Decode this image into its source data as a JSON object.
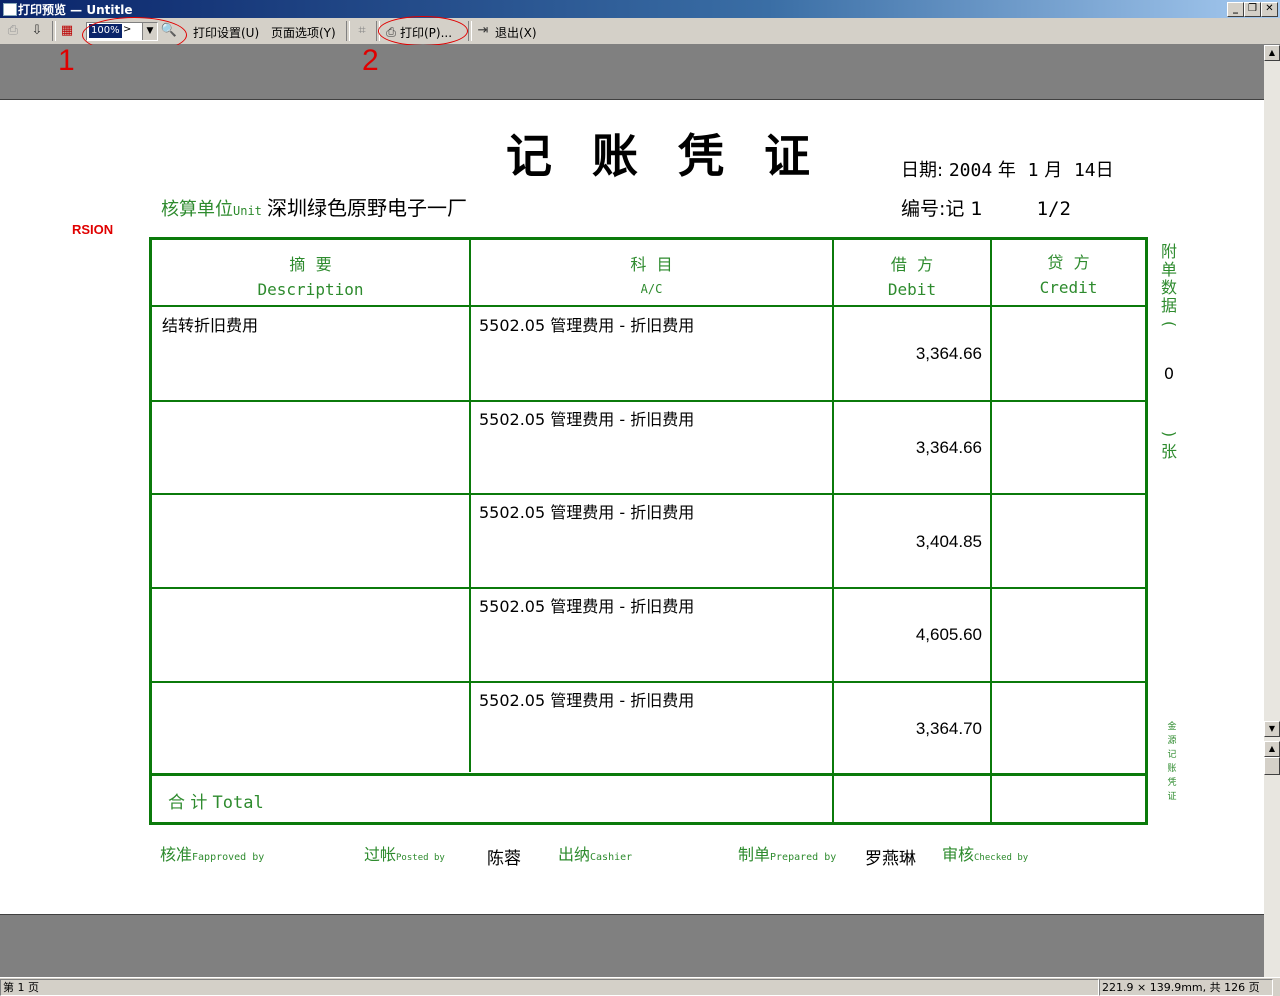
{
  "window": {
    "title": "打印预览 — Untitle"
  },
  "toolbar": {
    "zoom_value": "100%",
    "print_setup": "打印设置(U)",
    "page_options": "页面选项(Y)",
    "print": "打印(P)...",
    "exit": "退出(X)"
  },
  "annotations": {
    "callout1": "1",
    "callout2": "2"
  },
  "watermark": "RSION",
  "voucher": {
    "title": "记账凭证",
    "date_label": "日期:",
    "date_year": "2004",
    "year_unit": "年",
    "date_month": "1",
    "month_unit": "月",
    "date_day": "14",
    "day_unit": "日",
    "unit_label": "核算单位",
    "unit_label_en": "Unit",
    "unit_name": "深圳绿色原野电子一厂",
    "number_label": "编号:",
    "number_value": "记 1",
    "page_fraction": "1/2",
    "headers": {
      "summary_cn": "摘  要",
      "summary_en": "Description",
      "account_cn": "科  目",
      "account_en": "A/C",
      "debit_cn": "借  方",
      "debit_en": "Debit",
      "credit_cn": "贷  方",
      "credit_en": "Credit"
    },
    "rows": [
      {
        "summary": "结转折旧费用",
        "account": "5502.05 管理费用 - 折旧费用",
        "debit": "3,364.66",
        "credit": ""
      },
      {
        "summary": "",
        "account": "5502.05 管理费用 - 折旧费用",
        "debit": "3,364.66",
        "credit": ""
      },
      {
        "summary": "",
        "account": "5502.05 管理费用 - 折旧费用",
        "debit": "3,404.85",
        "credit": ""
      },
      {
        "summary": "",
        "account": "5502.05 管理费用 - 折旧费用",
        "debit": "4,605.60",
        "credit": ""
      },
      {
        "summary": "",
        "account": "5502.05 管理费用 - 折旧费用",
        "debit": "3,364.70",
        "credit": ""
      }
    ],
    "total_cn": "合 计",
    "total_en": "Total",
    "attachment_side": [
      "附",
      "单",
      "数",
      "据",
      "(",
      "0",
      ")",
      "张"
    ],
    "side_note": [
      "金",
      "源",
      "记",
      "账",
      "凭",
      "证"
    ],
    "signatures": {
      "approved_cn": "核准",
      "approved_en": "Fapproved by",
      "posted_cn": "过帐",
      "posted_en": "Posted by",
      "posted_name": "陈蓉",
      "cashier_cn": "出纳",
      "cashier_en": "Cashier",
      "prepared_cn": "制单",
      "prepared_en": "Prepared by",
      "prepared_name": "罗燕琳",
      "checked_cn": "审核",
      "checked_en": "Checked by"
    }
  },
  "status": {
    "page": "第 1 页",
    "paper_info": "221.9 × 139.9mm, 共 126 页"
  }
}
